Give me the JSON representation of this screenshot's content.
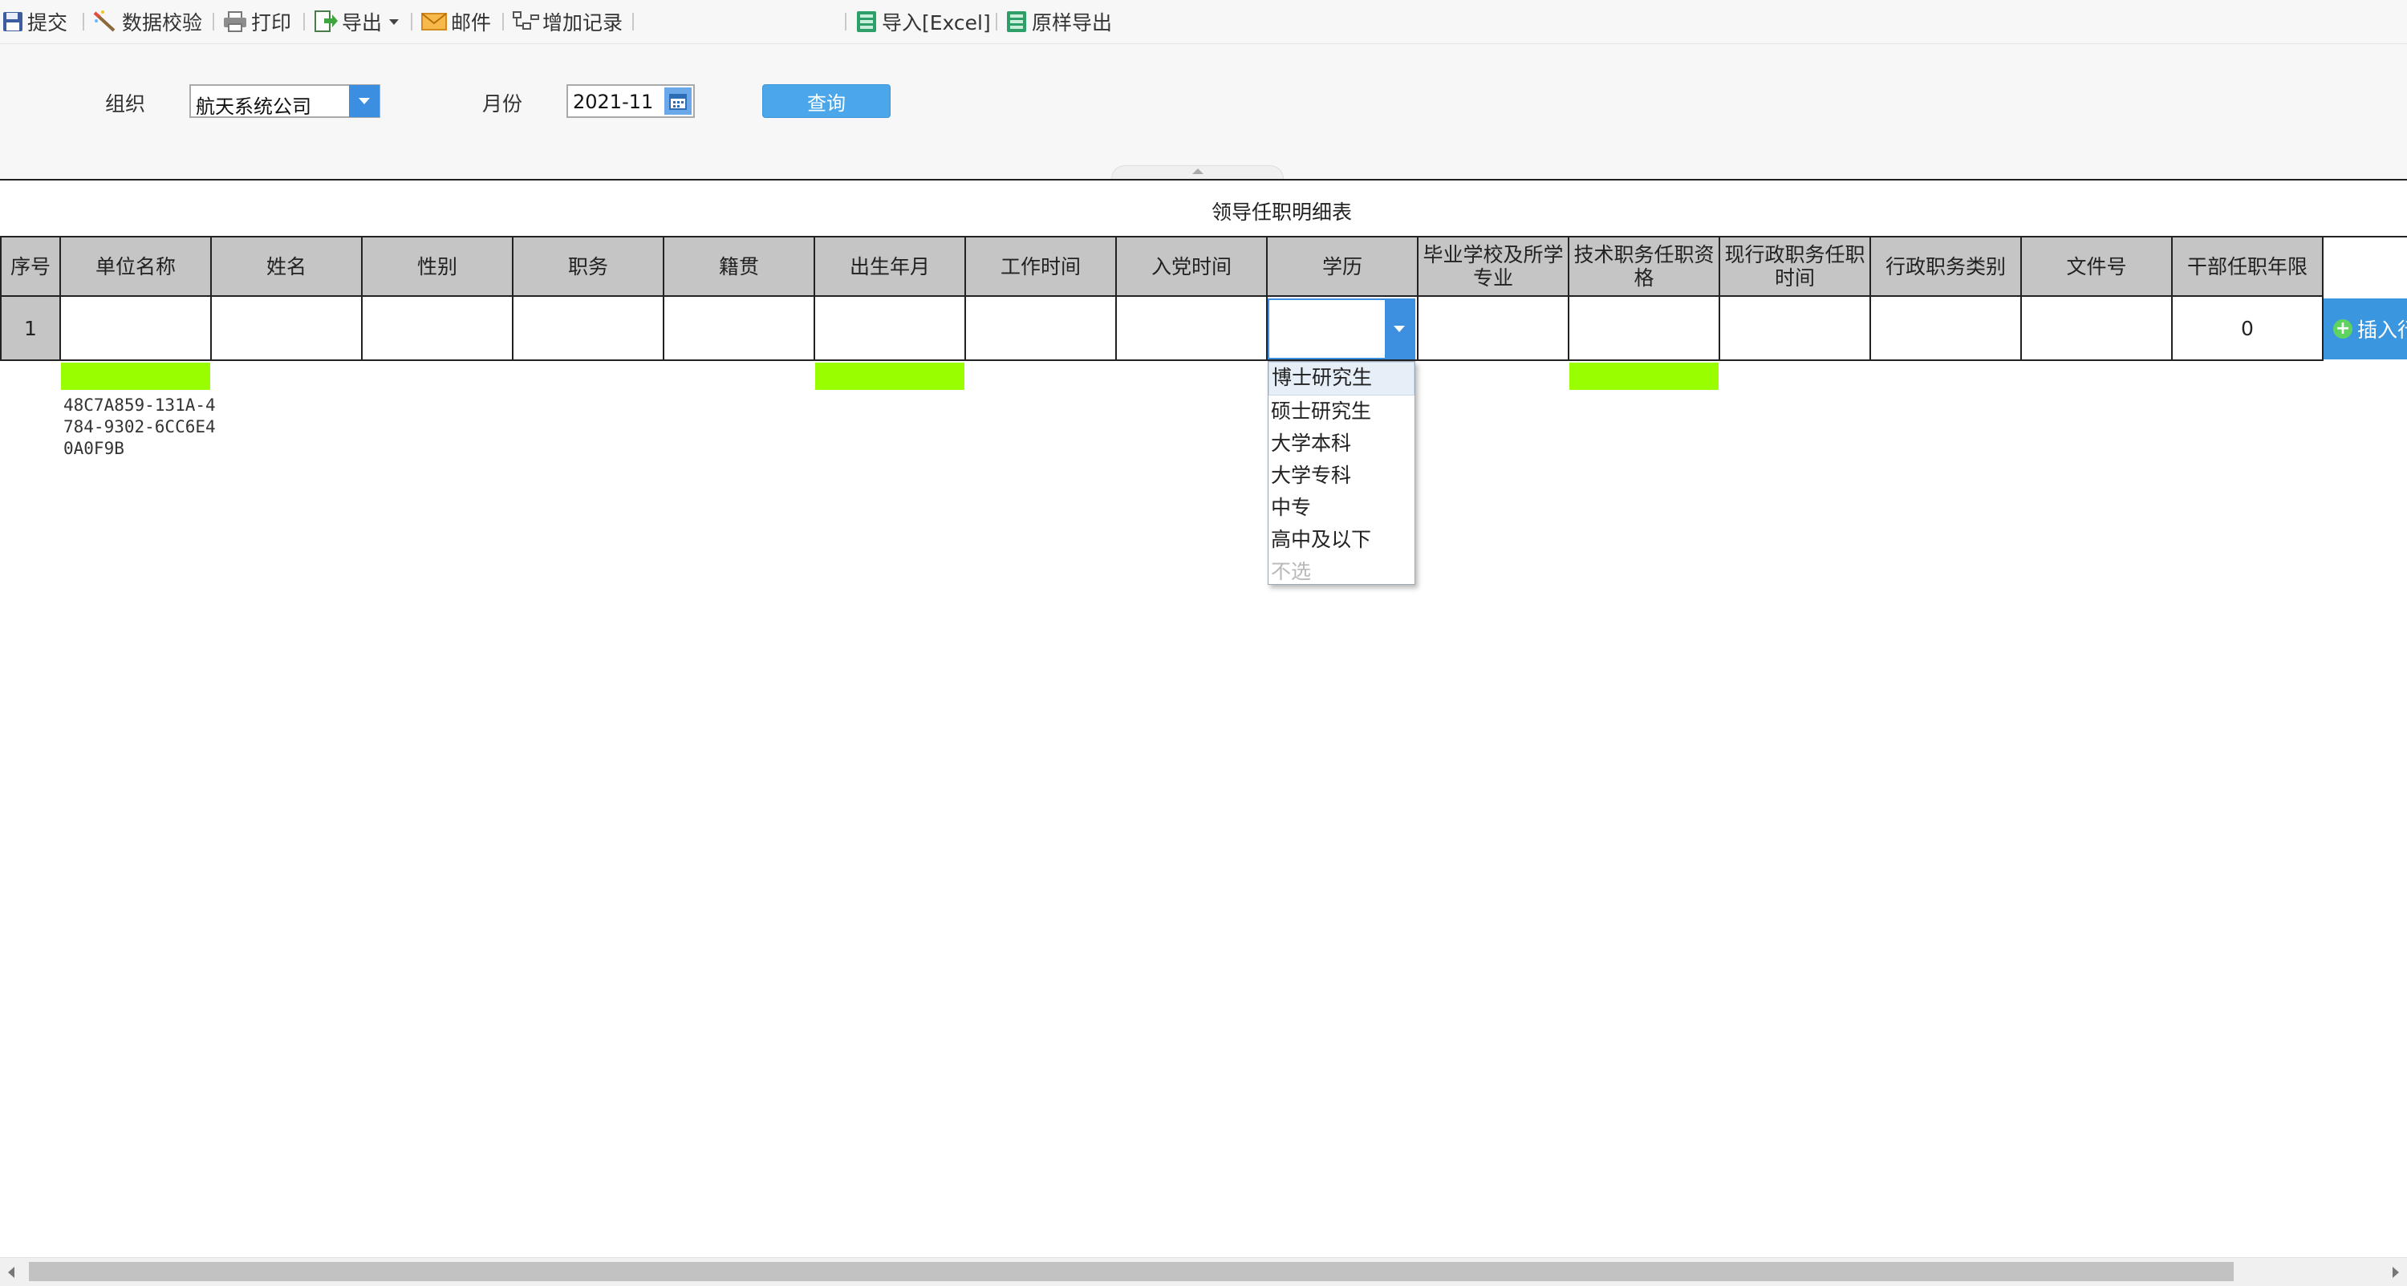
{
  "toolbar": {
    "submit": "提交",
    "validate": "数据校验",
    "print": "打印",
    "export": "导出",
    "mail": "邮件",
    "add_record": "增加记录",
    "import_excel": "导入[Excel]",
    "raw_export": "原样导出"
  },
  "filter": {
    "org_label": "组织",
    "org_value": "航天系统公司",
    "month_label": "月份",
    "month_value": "2021-11",
    "query_button": "查询"
  },
  "report": {
    "title": "领导任职明细表",
    "columns": [
      "序号",
      "单位名称",
      "姓名",
      "性别",
      "职务",
      "籍贯",
      "出生年月",
      "工作时间",
      "入党时间",
      "学历",
      "毕业学校及所学专业",
      "技术职务任职资格",
      "现行政职务任职时间",
      "行政职务类别",
      "文件号",
      "干部任职年限"
    ],
    "rows": [
      {
        "index": "1",
        "tenure": "0"
      }
    ],
    "guid": "48C7A859-131A-4784-9302-6CC6E40A0F9B",
    "insert_button": "插入行"
  },
  "education_dropdown": {
    "options": [
      "博士研究生",
      "硕士研究生",
      "大学本科",
      "大学专科",
      "中专",
      "高中及以下"
    ],
    "none_option": "不选"
  },
  "colors": {
    "accent": "#3d8fe0",
    "header_bg": "#c5c5c5",
    "highlight": "#99ff00"
  }
}
